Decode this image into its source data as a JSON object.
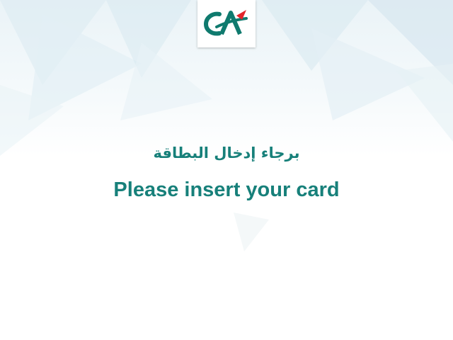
{
  "colors": {
    "text": "#17807a",
    "logo_green": "#0f7a6e",
    "logo_red": "#e3242b",
    "background_tint": "#eaf3f7"
  },
  "logo": {
    "icon": "credit-agricole-logo-icon"
  },
  "message": {
    "arabic": "برجاء إدخال البطاقة",
    "english": "Please insert your card"
  }
}
